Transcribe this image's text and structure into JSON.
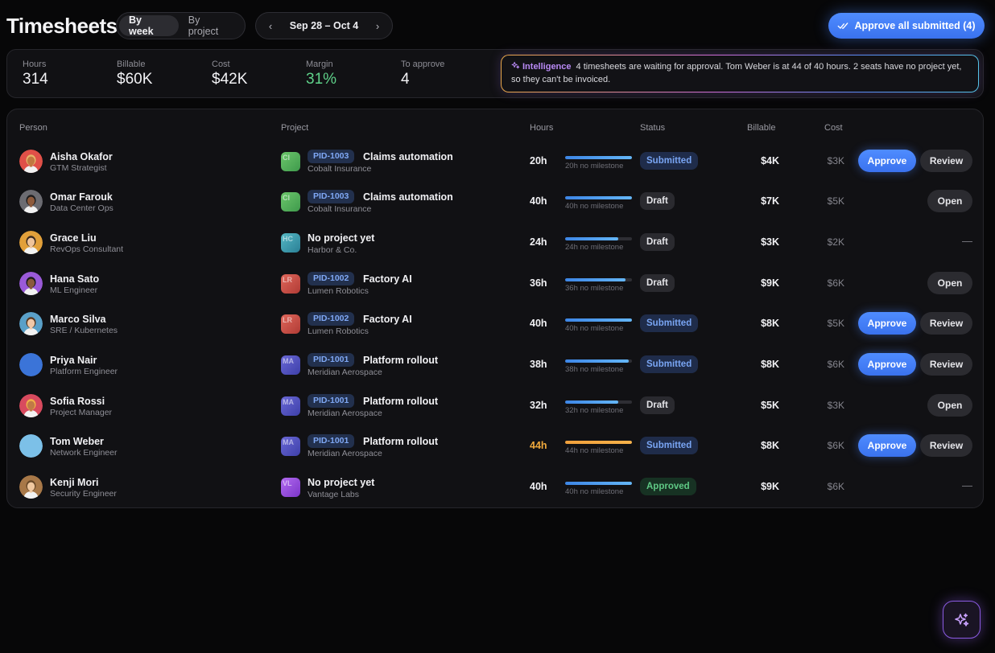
{
  "header": {
    "title": "Timesheets",
    "view_tabs": [
      {
        "label": "By week",
        "active": true
      },
      {
        "label": "By project",
        "active": false
      }
    ],
    "date_range": "Sep 28 – Oct 4",
    "approve_all_label": "Approve all submitted (4)"
  },
  "stats": [
    {
      "label": "Hours",
      "value": "314"
    },
    {
      "label": "Billable",
      "value": "$60K"
    },
    {
      "label": "Cost",
      "value": "$42K"
    },
    {
      "label": "Margin",
      "value": "31%"
    },
    {
      "label": "To approve",
      "value": "4"
    }
  ],
  "intelligence": {
    "tag": "Intelligence",
    "message": "4 timesheets are waiting for approval. Tom Weber is at 44 of 40 hours. 2 seats have no project yet, so they can't be invoiced."
  },
  "columns": [
    "Person",
    "Project",
    "Hours",
    "Status",
    "Billable",
    "Cost"
  ],
  "rows": [
    {
      "name": "Aisha Okafor",
      "role": "GTM Strategist",
      "logo": "CI",
      "pid": "PID-1003",
      "project": "Claims automation",
      "client": "Cobalt Insurance",
      "hours": "20h",
      "hours_fraction": 1.0,
      "bar_note": "20h no milestone",
      "status": "Submitted",
      "billable": "$4K",
      "cost": "$3K",
      "action": "approve_review"
    },
    {
      "name": "Omar Farouk",
      "role": "Data Center Ops",
      "logo": "CI",
      "pid": "PID-1003",
      "project": "Claims automation",
      "client": "Cobalt Insurance",
      "hours": "40h",
      "hours_fraction": 1.0,
      "bar_note": "40h no milestone",
      "status": "Draft",
      "billable": "$7K",
      "cost": "$5K",
      "action": "open"
    },
    {
      "name": "Grace Liu",
      "role": "RevOps Consultant",
      "logo": "HC",
      "pid": "",
      "project": "No project yet",
      "client": "Harbor & Co.",
      "hours": "24h",
      "hours_fraction": 0.8,
      "bar_note": "24h no milestone",
      "status": "Draft",
      "billable": "$3K",
      "cost": "$2K",
      "action": "none"
    },
    {
      "name": "Hana Sato",
      "role": "ML Engineer",
      "logo": "LR",
      "pid": "PID-1002",
      "project": "Factory AI",
      "client": "Lumen Robotics",
      "hours": "36h",
      "hours_fraction": 0.9,
      "bar_note": "36h no milestone",
      "status": "Draft",
      "billable": "$9K",
      "cost": "$6K",
      "action": "open"
    },
    {
      "name": "Marco Silva",
      "role": "SRE / Kubernetes",
      "logo": "LR",
      "pid": "PID-1002",
      "project": "Factory AI",
      "client": "Lumen Robotics",
      "hours": "40h",
      "hours_fraction": 1.0,
      "bar_note": "40h no milestone",
      "status": "Submitted",
      "billable": "$8K",
      "cost": "$5K",
      "action": "approve_review"
    },
    {
      "name": "Priya Nair",
      "role": "Platform Engineer",
      "logo": "MA",
      "pid": "PID-1001",
      "project": "Platform rollout",
      "client": "Meridian Aerospace",
      "hours": "38h",
      "hours_fraction": 0.95,
      "bar_note": "38h no milestone",
      "status": "Submitted",
      "billable": "$8K",
      "cost": "$6K",
      "action": "approve_review"
    },
    {
      "name": "Sofia Rossi",
      "role": "Project Manager",
      "logo": "MA",
      "pid": "PID-1001",
      "project": "Platform rollout",
      "client": "Meridian Aerospace",
      "hours": "32h",
      "hours_fraction": 0.8,
      "bar_note": "32h no milestone",
      "status": "Draft",
      "billable": "$5K",
      "cost": "$3K",
      "action": "open"
    },
    {
      "name": "Tom Weber",
      "role": "Network Engineer",
      "logo": "MA",
      "pid": "PID-1001",
      "project": "Platform rollout",
      "client": "Meridian Aerospace",
      "hours": "44h",
      "hours_fraction": 1.0,
      "over": true,
      "bar_note": "44h no milestone",
      "status": "Submitted",
      "billable": "$8K",
      "cost": "$6K",
      "action": "approve_review"
    },
    {
      "name": "Kenji Mori",
      "role": "Security Engineer",
      "logo": "VL",
      "pid": "",
      "project": "No project yet",
      "client": "Vantage Labs",
      "hours": "40h",
      "hours_fraction": 1.0,
      "bar_note": "40h no milestone",
      "status": "Approved",
      "billable": "$9K",
      "cost": "$6K",
      "action": "none"
    }
  ],
  "actions": {
    "approve": "Approve",
    "review": "Review",
    "open": "Open",
    "none": "—"
  },
  "colors": {
    "accent": "#3f7cf4",
    "approved": "#5fc985",
    "over_budget": "#f0a93c",
    "intelligence": "#b98af5"
  },
  "icons": {
    "approve_all": "double-check-icon",
    "intelligence": "sparkle-icon",
    "fab": "sparkle-icon"
  }
}
